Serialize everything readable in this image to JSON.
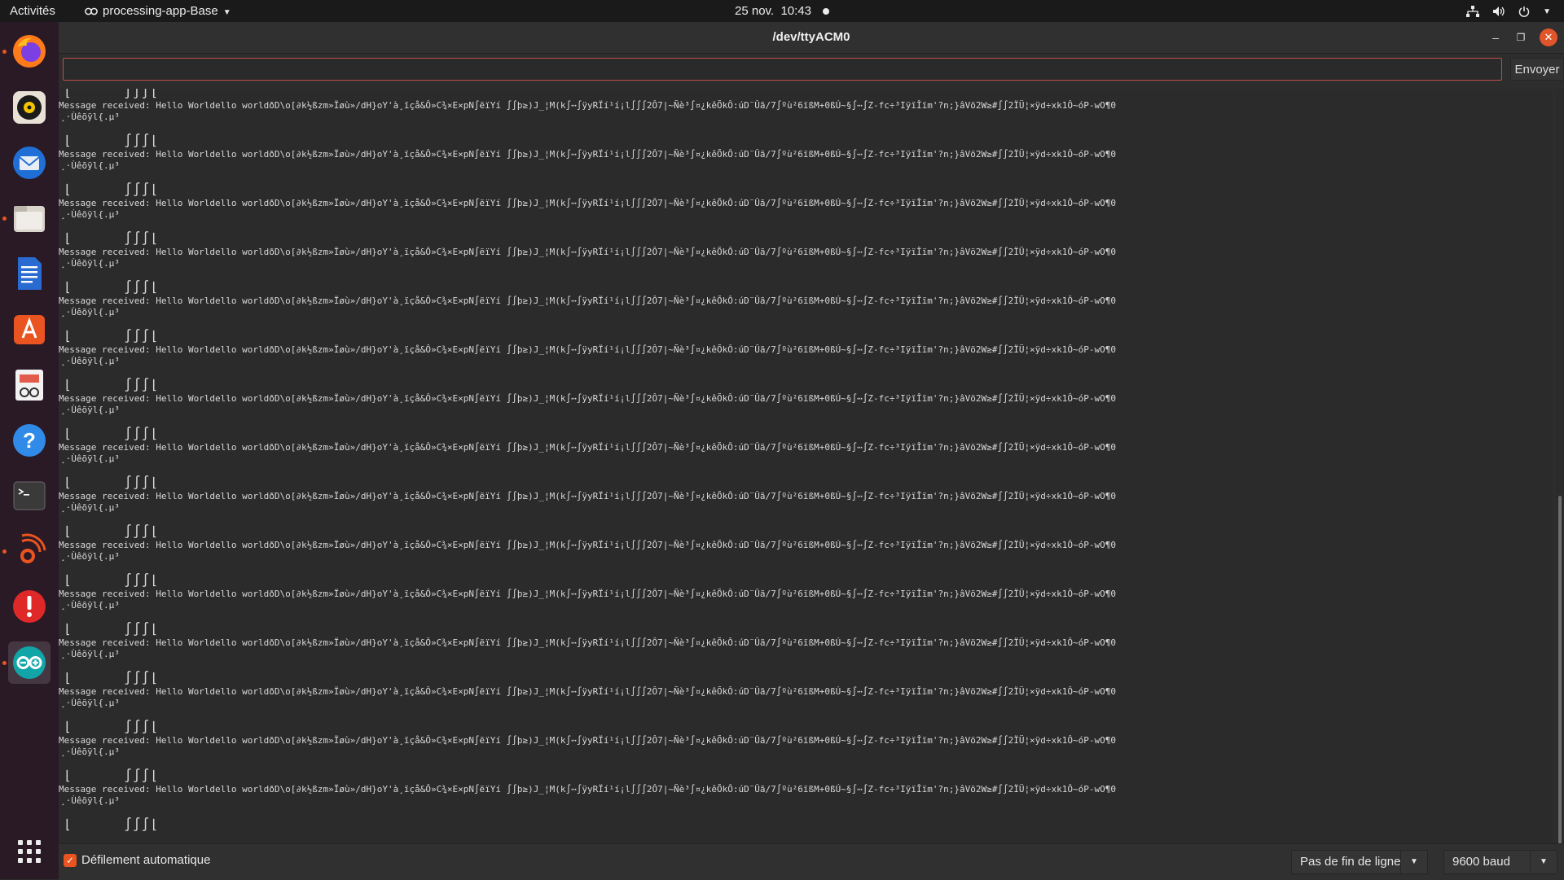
{
  "topbar": {
    "activities": "Activités",
    "app_name": "processing-app-Base",
    "date": "25 nov.",
    "time": "10:43"
  },
  "dock": {
    "items": [
      {
        "name": "firefox-icon"
      },
      {
        "name": "rhythmbox-icon"
      },
      {
        "name": "thunderbird-icon"
      },
      {
        "name": "files-icon"
      },
      {
        "name": "libreoffice-writer-icon"
      },
      {
        "name": "software-center-icon"
      },
      {
        "name": "document-viewer-icon"
      },
      {
        "name": "help-icon"
      },
      {
        "name": "terminal-icon"
      },
      {
        "name": "ubuntu-podcast-icon"
      },
      {
        "name": "error-report-icon"
      },
      {
        "name": "arduino-icon"
      },
      {
        "name": "show-apps-icon"
      }
    ]
  },
  "window": {
    "title": "/dev/ttyACM0",
    "send_label": "Envoyer",
    "input_value": ""
  },
  "console": {
    "garbage_line": "⌊      ∫∫∫⌊",
    "message_line": "Message received: Hello Worldello worldðD\\o[∂k½ßzm»Ïøù»/dH}oY'à¸ïçå&Ô»C¾×E×pN∫ëïYí ∫∫þ≥)J_¦M(k∫⋯∫ÿyRÏí¹í¡l∫∫∫2Ô7|~Ñè³∫¤¿kêÕkÔ:úD¨Ûã/7∫ºù²6ïßM+0ßÚ~§∫⋯∫Z-fc÷³IÿïÎïm'?n;}âVö2W≥#∫∫2ÏÜ¦×ÿd÷xk1Ô~óP-wO¶0",
    "message_tail": "¸·Ùêõÿl{.µ³",
    "message_count": 15,
    "final_line": "⌊      ∫∫∫⌊"
  },
  "footer": {
    "autoscroll_label": "Défilement automatique",
    "autoscroll_checked": true,
    "line_ending": "Pas de fin de ligne",
    "baud": "9600 baud"
  },
  "colors": {
    "accent": "#e95420",
    "console_bg": "#2b2b2b",
    "dock_bg": "#2a1a26",
    "close_button": "#e0552b"
  }
}
